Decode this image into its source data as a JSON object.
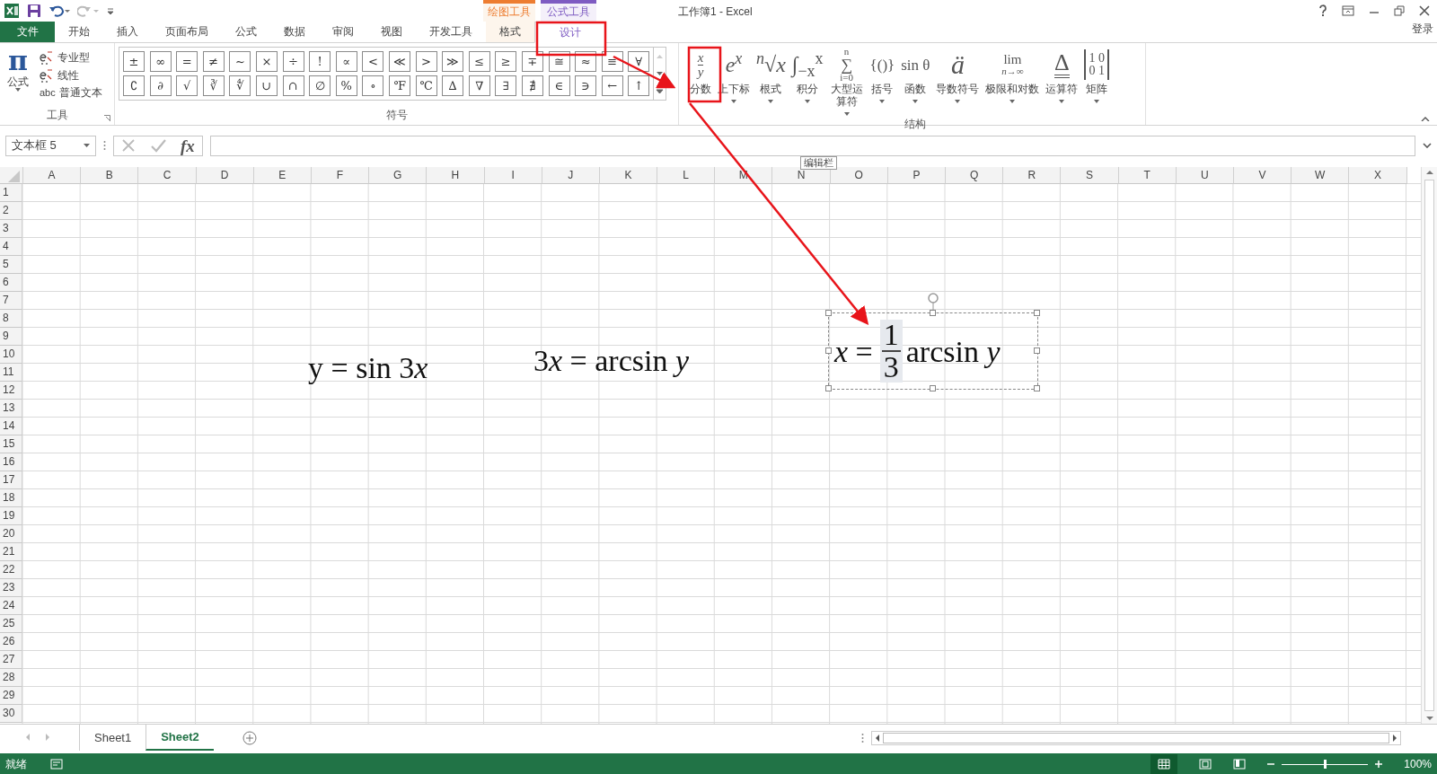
{
  "window": {
    "title": "工作簿1 - Excel",
    "login": "登录"
  },
  "context_groups": [
    {
      "label": "绘图工具",
      "color": "#ed7d31"
    },
    {
      "label": "公式工具",
      "color": "#7e5bc2"
    }
  ],
  "tabs": [
    {
      "label": "文件",
      "kind": "file",
      "selected": false
    },
    {
      "label": "开始",
      "selected": false
    },
    {
      "label": "插入",
      "selected": false
    },
    {
      "label": "页面布局",
      "selected": false
    },
    {
      "label": "公式",
      "selected": false
    },
    {
      "label": "数据",
      "selected": false
    },
    {
      "label": "审阅",
      "selected": false
    },
    {
      "label": "视图",
      "selected": false
    },
    {
      "label": "开发工具",
      "selected": false
    },
    {
      "label": "格式",
      "kind": "context",
      "selected": false
    },
    {
      "label": "设计",
      "kind": "context",
      "selected": true
    }
  ],
  "tools_group": {
    "label": "工具",
    "equation": {
      "symbol": "π",
      "label": "公式"
    },
    "items": [
      "专业型",
      "线性",
      "普通文本"
    ],
    "plain_prefix": "abc"
  },
  "symbols_group": {
    "label": "符号",
    "rows": [
      [
        "±",
        "∞",
        "=",
        "≠",
        "~",
        "×",
        "÷",
        "!",
        "∝",
        "<",
        "≪",
        ">",
        "≫",
        "≤",
        "≥",
        "∓",
        "≅",
        "≈",
        "≡",
        "∀"
      ],
      [
        "∁",
        "∂",
        "√",
        "∛",
        "∜",
        "∪",
        "∩",
        "∅",
        "%",
        "∘",
        "℉",
        "℃",
        "∆",
        "∇",
        "∃",
        "∄",
        "∈",
        "∋",
        "←",
        "↑"
      ]
    ]
  },
  "structures_group": {
    "label": "结构",
    "items": [
      {
        "label": "分数",
        "kind": "stack",
        "lines": [
          "x",
          "y"
        ],
        "rule": true,
        "caret": false
      },
      {
        "label": "上下标",
        "kind": "symbol",
        "symbol": "e$^{x}$",
        "caret": true
      },
      {
        "label": "根式",
        "kind": "symbol",
        "symbol": "$^{n}$√x",
        "caret": true
      },
      {
        "label": "积分",
        "kind": "symbol",
        "symbol": "∫$_{−x}$$^{x}$",
        "caret": true
      },
      {
        "label": "大型运算符",
        "kind": "stack",
        "lines": [
          "n",
          "∑",
          "i=0"
        ],
        "rule": false,
        "caret": true
      },
      {
        "label": "括号",
        "kind": "symbol",
        "symbol": "{()}",
        "caret": true
      },
      {
        "label": "函数",
        "kind": "symbol",
        "symbol": "sin θ",
        "caret": true
      },
      {
        "label": "导数符号",
        "kind": "symbol",
        "symbol": "ä",
        "caret": true
      },
      {
        "label": "极限和对数",
        "kind": "stack",
        "lines": [
          "lim",
          "n→∞"
        ],
        "rule": false,
        "caret": true
      },
      {
        "label": "运算符",
        "kind": "operator",
        "symbol": "Δ",
        "caret": true
      },
      {
        "label": "矩阵",
        "kind": "matrix",
        "lines": [
          "1 0",
          "0 1"
        ],
        "caret": true
      }
    ]
  },
  "name_box": "文本框 5",
  "formula_fx": "fx",
  "tooltip": "编辑栏",
  "columns": [
    "A",
    "B",
    "C",
    "D",
    "E",
    "F",
    "G",
    "H",
    "I",
    "J",
    "K",
    "L",
    "M",
    "N",
    "O",
    "P",
    "Q",
    "R",
    "S",
    "T",
    "U",
    "V",
    "W",
    "X"
  ],
  "rows": [
    "1",
    "2",
    "3",
    "4",
    "5",
    "6",
    "7",
    "8",
    "9",
    "10",
    "11",
    "12",
    "13",
    "14",
    "15",
    "16",
    "17",
    "18",
    "19",
    "20",
    "21",
    "22",
    "23",
    "24",
    "25",
    "26",
    "27",
    "28",
    "29",
    "30"
  ],
  "equations": [
    {
      "kind": "plain",
      "parts": [
        {
          "text": "y = sin 3",
          "italic": false
        },
        {
          "text": "x",
          "italic": true
        }
      ],
      "selected": false
    },
    {
      "kind": "plain",
      "parts": [
        {
          "text": "3",
          "italic": false
        },
        {
          "text": "x",
          "italic": true
        },
        {
          "text": " = arcsin ",
          "italic": false
        },
        {
          "text": "y",
          "italic": true
        }
      ],
      "selected": false
    },
    {
      "kind": "fraction",
      "before": [
        {
          "text": "x",
          "italic": true
        },
        {
          "text": " =",
          "italic": false
        }
      ],
      "numerator": "1",
      "denominator": "3",
      "after": [
        {
          "text": "arcsin ",
          "italic": false
        },
        {
          "text": "y",
          "italic": true
        }
      ],
      "selected": true
    }
  ],
  "sheets": [
    {
      "label": "Sheet1",
      "selected": false
    },
    {
      "label": "Sheet2",
      "selected": true
    }
  ],
  "status_bar": {
    "text": "就绪",
    "zoom_text": "100%",
    "zoom": {
      "level": 0.5
    }
  }
}
